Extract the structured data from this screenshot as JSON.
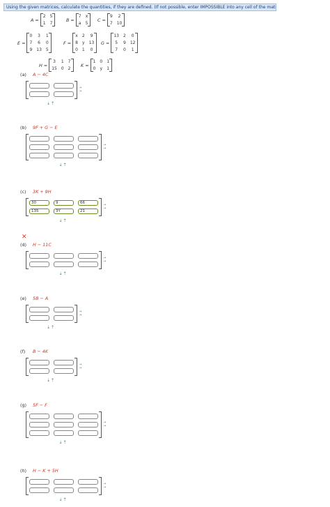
{
  "instructions": "Using the given matrices, calculate the quantities, if they are defined. (If not possible, enter IMPOSSIBLE into any cell of the matrix.)",
  "matrices": {
    "A": {
      "name": "A =",
      "rows": [
        [
          "2",
          "5"
        ],
        [
          "1",
          "7"
        ]
      ]
    },
    "B": {
      "name": "B =",
      "rows": [
        [
          "7",
          "x"
        ],
        [
          "a",
          "5"
        ]
      ]
    },
    "C": {
      "name": "C =",
      "rows": [
        [
          "9",
          "2"
        ],
        [
          "7",
          "10"
        ]
      ]
    },
    "E": {
      "name": "E =",
      "rows": [
        [
          "0",
          "3",
          "1"
        ],
        [
          "7",
          "6",
          "0"
        ],
        [
          "9",
          "13",
          "5"
        ]
      ]
    },
    "F": {
      "name": "F =",
      "rows": [
        [
          "x",
          "2",
          "9"
        ],
        [
          "8",
          "y",
          "13"
        ],
        [
          "0",
          "1",
          "0"
        ]
      ]
    },
    "G": {
      "name": "G =",
      "rows": [
        [
          "13",
          "2",
          "0"
        ],
        [
          "5",
          "9",
          "12"
        ],
        [
          "7",
          "0",
          "1"
        ]
      ]
    },
    "H": {
      "name": "H =",
      "rows": [
        [
          "3",
          "1",
          "7"
        ],
        [
          "15",
          "0",
          "2"
        ]
      ]
    },
    "K": {
      "name": "K =",
      "rows": [
        [
          "1",
          "0",
          "1"
        ],
        [
          "0",
          "y",
          "1"
        ]
      ]
    }
  },
  "parts": [
    {
      "letter": "(a)",
      "expr": "A − 4C",
      "cells": [
        [
          "",
          ""
        ],
        [
          "",
          ""
        ]
      ]
    },
    {
      "letter": "(b)",
      "expr": "9F + G − E",
      "cells": [
        [
          "",
          "",
          ""
        ],
        [
          "",
          "",
          ""
        ],
        [
          "",
          "",
          ""
        ]
      ]
    },
    {
      "letter": "(c)",
      "expr": "3K + 9H",
      "cells": [
        [
          "30",
          "9",
          "66"
        ],
        [
          "135",
          "3Y",
          "21"
        ]
      ]
    },
    {
      "letter": "(d)",
      "expr": "H − 11C",
      "cells": [
        [
          "",
          "",
          ""
        ],
        [
          "",
          "",
          ""
        ]
      ]
    },
    {
      "letter": "(e)",
      "expr": "5B − A",
      "cells": [
        [
          "",
          ""
        ],
        [
          "",
          ""
        ]
      ]
    },
    {
      "letter": "(f)",
      "expr": "B − 4K",
      "cells": [
        [
          "",
          ""
        ],
        [
          "",
          ""
        ]
      ]
    },
    {
      "letter": "(g)",
      "expr": "5F − F",
      "cells": [
        [
          "",
          "",
          ""
        ],
        [
          "",
          "",
          ""
        ],
        [
          "",
          "",
          ""
        ]
      ]
    },
    {
      "letter": "(h)",
      "expr": "H − K + 5H",
      "cells": [
        [
          "",
          "",
          ""
        ],
        [
          "",
          "",
          ""
        ]
      ]
    }
  ],
  "arrow_right": "⇢",
  "arrow_down": "⇣⇡",
  "wrong_mark": "✕",
  "colors": {
    "accent": "#c0392b",
    "arrow": "#2e7d32",
    "banner": "#d6e6fa"
  }
}
